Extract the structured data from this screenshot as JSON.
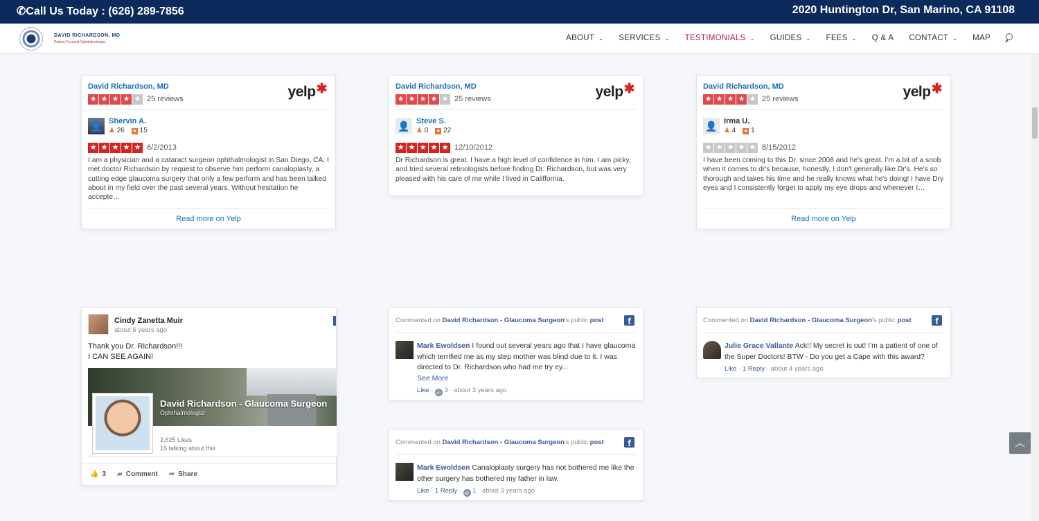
{
  "topbar": {
    "phone": "Call Us Today : (626) 289-7856",
    "address": "2020 Huntington Dr, San Marino, CA 91108"
  },
  "logo": {
    "name": "DAVID RICHARDSON, MD",
    "tagline": "Patient-Focused Ophthalmologist"
  },
  "menu": [
    {
      "label": "ABOUT",
      "has_dropdown": true
    },
    {
      "label": "SERVICES",
      "has_dropdown": true
    },
    {
      "label": "TESTIMONIALS",
      "has_dropdown": true,
      "active": true
    },
    {
      "label": "GUIDES",
      "has_dropdown": true
    },
    {
      "label": "FEES",
      "has_dropdown": true
    },
    {
      "label": "Q & A",
      "has_dropdown": false
    },
    {
      "label": "CONTACT",
      "has_dropdown": true
    },
    {
      "label": "MAP",
      "has_dropdown": false
    }
  ],
  "colors": {
    "topbar": "#0c2a5b",
    "active_menu": "#b3164b",
    "link_blue": "#1a6fb5",
    "yelp_red": "#d32323",
    "facebook_blue": "#3b5998"
  },
  "yelp_cards": [
    {
      "business": "David Richardson, MD",
      "rating": 4,
      "review_count": "25 reviews",
      "logo_text": "yelp",
      "reviewer": "Shervin A.",
      "friends": "26",
      "reviews": "15",
      "review_rating": 5,
      "review_date": "6/2/2013",
      "text": "I am a physician and a cataract surgeon ophthalmologist in San Diego, CA. I met doctor Richardson by request to observe him perform canaloplasty, a cutting edge glaucoma surgery that only a few perform and has been talked about in my field over the past several years. Without hesitation he accepte…",
      "read_more": "Read more on Yelp"
    },
    {
      "business": "David Richardson, MD",
      "rating": 4,
      "review_count": "25 reviews",
      "logo_text": "yelp",
      "reviewer": "Steve S.",
      "friends": "0",
      "reviews": "22",
      "review_rating": 5,
      "review_date": "12/10/2012",
      "text": "Dr Richardson is great. I have a high level of confidence in him. I am picky, and tried several retinologists before finding Dr. Richardson, but was very pleased with his care of me while I lived in Califfornia.",
      "read_more": ""
    },
    {
      "business": "David Richardson, MD",
      "rating": 4,
      "review_count": "25 reviews",
      "logo_text": "yelp",
      "reviewer": "Irma U.",
      "friends": "4",
      "reviews": "1",
      "review_rating": 0,
      "review_date": "8/15/2012",
      "text": "I have been coming to this Dr. since 2008 and he's great. I'm a bit of a snob when it comes to dr's because, honestly, I don't generally like Dr's. He's so thorough and takes his time and he really knows what he's doing! I have Dry eyes and I consistently forget to apply my eye drops and whenever I…",
      "read_more": "Read more on Yelp"
    }
  ],
  "fb_post": {
    "author": "Cindy Zanetta Muir",
    "time": "about 6 years ago",
    "message_line1": "Thank you Dr. Richardson!!!",
    "message_line2": "I CAN SEE AGAIN!",
    "page_title": "David Richardson - Glaucoma Surgeon",
    "page_category": "Ophthalmologist",
    "page_likes": "2,625 Likes",
    "page_talking": "15 talking about this",
    "like_count": "3",
    "comment_label": "Comment",
    "share_label": "Share"
  },
  "fb_comments": [
    {
      "prefix": "Commented on",
      "page": "David Richardson - Glaucoma Surgeon",
      "suffix": "'s public",
      "post": "post",
      "commenter": "Mark Ewoldsen",
      "text": " I found out several years ago that I have glaucoma which terrified me as my step mother was blind due to it. I was directed to Dr. Richardson who had me try ey...",
      "see_more": "See More",
      "like": "Like",
      "reply": "",
      "reactions": "3",
      "time": "about 3 years ago"
    },
    {
      "prefix": "Commented on",
      "page": "David Richardson - Glaucoma Surgeon",
      "suffix": "'s public",
      "post": "post",
      "commenter": "Julie Grace Vallante",
      "text": " Ack!! My secret is out! I'm a patient of one of the Super Doctors! BTW - Do you get a Cape with this award?",
      "see_more": "",
      "like": "Like",
      "reply": "1 Reply",
      "reactions": "",
      "time": "about 4 years ago"
    },
    {
      "prefix": "Commented on",
      "page": "David Richardson - Glaucoma Surgeon",
      "suffix": "'s public",
      "post": "post",
      "commenter": "Mark Ewoldsen",
      "text": " Canaloplasty surgery has not bothered me like the other surgery has bothered my father in law.",
      "see_more": "",
      "like": "Like",
      "reply": "1 Reply",
      "reactions": "1",
      "time": "about 3 years ago"
    }
  ]
}
